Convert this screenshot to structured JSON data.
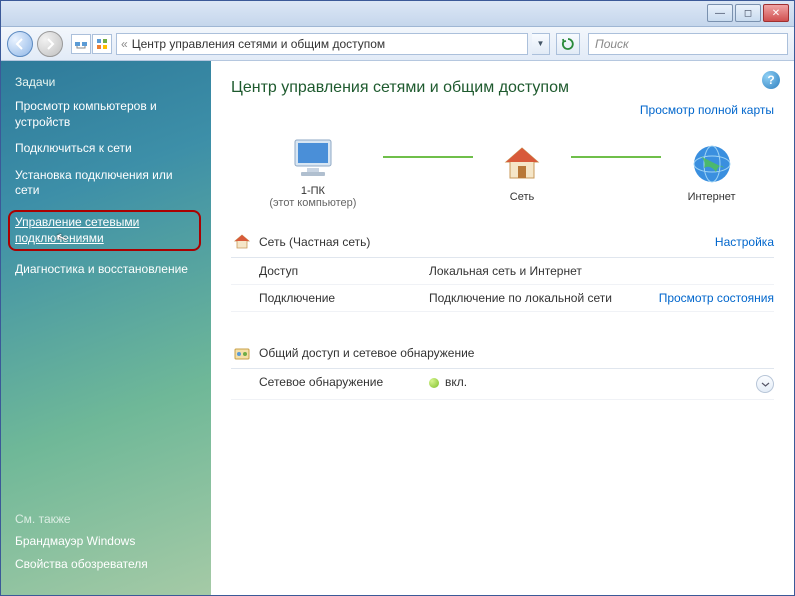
{
  "address_bar": {
    "title": "Центр управления сетями и общим доступом"
  },
  "search": {
    "placeholder": "Поиск"
  },
  "sidebar": {
    "tasks_heading": "Задачи",
    "items": [
      "Просмотр компьютеров и устройств",
      "Подключиться к сети",
      "Установка подключения или сети",
      "Управление сетевыми подключениями",
      "Диагностика и восстановление"
    ],
    "see_also_heading": "См. также",
    "see_also": [
      "Брандмауэр Windows",
      "Свойства обозревателя"
    ]
  },
  "content": {
    "title": "Центр управления сетями и общим доступом",
    "view_full_map": "Просмотр полной карты",
    "nodes": {
      "pc_label": "1-ПК",
      "pc_sub": "(этот компьютер)",
      "net_label": "Сеть",
      "inet_label": "Интернет"
    },
    "network_section": {
      "title": "Сеть (Частная сеть)",
      "action": "Настройка",
      "rows": [
        {
          "k": "Доступ",
          "v": "Локальная сеть и Интернет",
          "a": ""
        },
        {
          "k": "Подключение",
          "v": "Подключение по локальной сети",
          "a": "Просмотр состояния"
        }
      ]
    },
    "sharing_section": {
      "title": "Общий доступ и сетевое обнаружение",
      "row": {
        "k": "Сетевое обнаружение",
        "v": "вкл."
      }
    }
  }
}
